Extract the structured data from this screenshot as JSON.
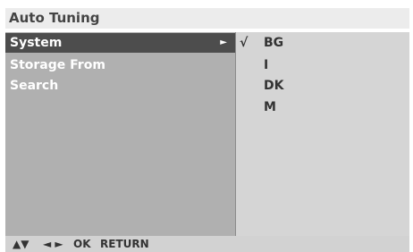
{
  "title": "Auto Tuning",
  "menu": {
    "items": [
      {
        "label": "System",
        "arrow": "►"
      },
      {
        "label": "Storage From"
      },
      {
        "label": "Search"
      }
    ]
  },
  "options": {
    "check_mark": "√",
    "items": [
      {
        "label": "BG",
        "checked": true
      },
      {
        "label": "I"
      },
      {
        "label": "DK"
      },
      {
        "label": "M"
      }
    ]
  },
  "footer": {
    "up_down": "▲▼",
    "left_right": "◄ ►",
    "ok": "OK",
    "return": "RETURN"
  }
}
